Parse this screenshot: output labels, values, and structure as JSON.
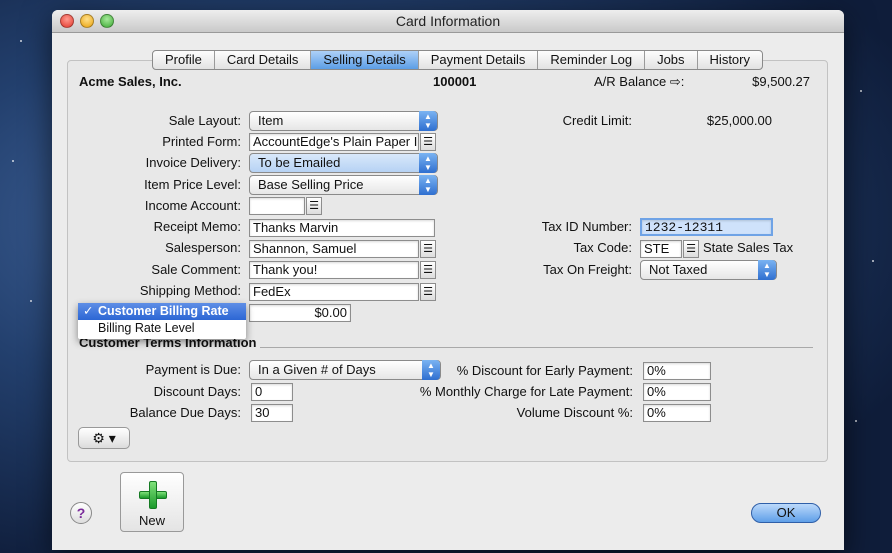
{
  "window": {
    "title": "Card Information"
  },
  "tabs": [
    "Profile",
    "Card Details",
    "Selling Details",
    "Payment Details",
    "Reminder Log",
    "Jobs",
    "History"
  ],
  "active_tab_index": 2,
  "header": {
    "company": "Acme Sales, Inc.",
    "card_id": "100001",
    "ar_balance_label": "A/R Balance",
    "ar_balance_arrow": "⇨:",
    "ar_balance_value": "$9,500.27"
  },
  "form": {
    "sale_layout": {
      "label": "Sale Layout:",
      "value": "Item"
    },
    "printed_form": {
      "label": "Printed Form:",
      "value": "AccountEdge's Plain Paper In"
    },
    "invoice_delivery": {
      "label": "Invoice Delivery:",
      "value": "To be Emailed"
    },
    "item_price_level": {
      "label": "Item Price Level:",
      "value": "Base Selling Price"
    },
    "income_account": {
      "label": "Income Account:",
      "value": ""
    },
    "receipt_memo": {
      "label": "Receipt Memo:",
      "value": "Thanks Marvin"
    },
    "salesperson": {
      "label": "Salesperson:",
      "value": "Shannon, Samuel"
    },
    "sale_comment": {
      "label": "Sale Comment:",
      "value": "Thank you!"
    },
    "shipping_method": {
      "label": "Shipping Method:",
      "value": "FedEx"
    },
    "billing_rate_value": "$0.00",
    "credit_limit": {
      "label": "Credit Limit:",
      "value": "$25,000.00"
    },
    "tax_id": {
      "label": "Tax ID Number:",
      "value": "1232-12311"
    },
    "tax_code": {
      "label": "Tax Code:",
      "value": "STE",
      "desc": "State Sales Tax"
    },
    "tax_on_freight": {
      "label": "Tax On Freight:",
      "value": "Not Taxed"
    }
  },
  "billing_menu": {
    "items": [
      "Customer Billing Rate",
      "Billing Rate Level"
    ],
    "selected_index": 0,
    "check": "✓"
  },
  "terms": {
    "section_title": "Customer Terms Information",
    "payment_is_due": {
      "label": "Payment is Due:",
      "value": "In a Given # of Days"
    },
    "discount_days": {
      "label": "Discount Days:",
      "value": "0"
    },
    "balance_due_days": {
      "label": "Balance Due Days:",
      "value": "30"
    },
    "early_payment_discount": {
      "label": "% Discount for Early Payment:",
      "value": "0%"
    },
    "late_payment_charge": {
      "label": "% Monthly Charge for Late Payment:",
      "value": "0%"
    },
    "volume_discount": {
      "label": "Volume Discount %:",
      "value": "0%"
    }
  },
  "buttons": {
    "new": "New",
    "ok": "OK",
    "help": "?",
    "gear": "⚙ ▾"
  },
  "icons": {
    "lookup": "list-lookup-icon",
    "popup": "popup-arrows-icon"
  },
  "colors": {
    "active_tab": "#5c9ee6",
    "menu_selected": "#2c66d4",
    "new_plus": "#1b9a2b"
  }
}
